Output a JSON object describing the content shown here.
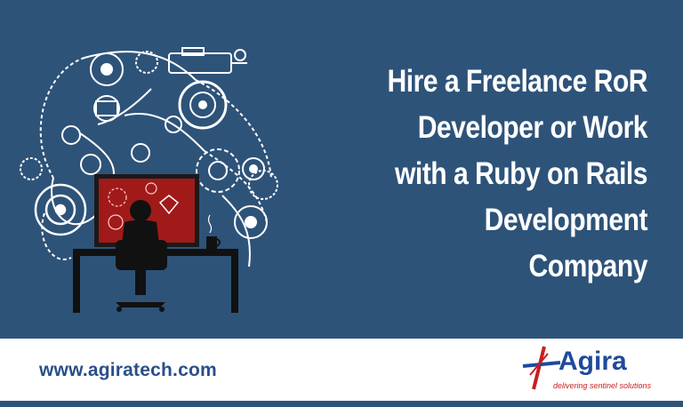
{
  "headline": {
    "lines": [
      "Hire a Freelance RoR",
      "Developer or Work",
      "with a Ruby on Rails",
      "Development",
      "Company"
    ]
  },
  "footer": {
    "website": "www.agiratech.com",
    "logo_name": "Agira",
    "logo_tagline": "delivering sentinel solutions"
  },
  "colors": {
    "background": "#2e5379",
    "headline_text": "#ffffff",
    "footer_background": "#ffffff",
    "website_text": "#2a4f8a",
    "logo_blue": "#1e4a9c",
    "logo_red": "#c81e1e",
    "screen_red": "#a11a1a"
  },
  "icons": [
    "gear-machinery-icon",
    "developer-at-desk-icon",
    "coffee-mug-icon",
    "ruby-gem-icon",
    "agira-logo-mark-icon"
  ]
}
